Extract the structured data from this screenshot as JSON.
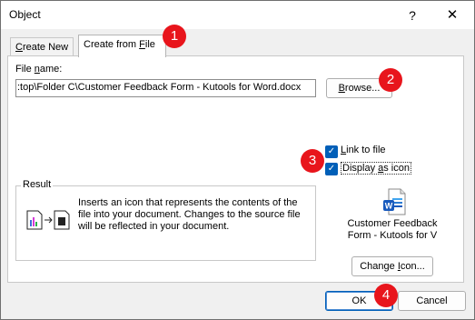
{
  "window": {
    "title": "Object",
    "help_symbol": "?",
    "close_symbol": "✕"
  },
  "tabs": [
    {
      "label_pre": "",
      "label_mnemonic": "C",
      "label_post": "reate New",
      "active": false
    },
    {
      "label_pre": "Create from ",
      "label_mnemonic": "F",
      "label_post": "ile",
      "active": true
    }
  ],
  "file": {
    "label_pre": "File ",
    "label_mnemonic": "n",
    "label_post": "ame:",
    "value": ":top\\Folder C\\Customer Feedback Form - Kutools for Word.docx",
    "browse_pre": "",
    "browse_mnemonic": "B",
    "browse_post": "rowse..."
  },
  "options": {
    "link_to_file": {
      "label_pre": "",
      "label_mnemonic": "L",
      "label_post": "ink to file",
      "checked": true
    },
    "display_as_icon": {
      "label_pre": "Display ",
      "label_mnemonic": "a",
      "label_post": "s icon",
      "checked": true
    }
  },
  "result": {
    "legend": "Result",
    "text": "Inserts an icon that represents the contents of the file into your document.  Changes to the source file will be reflected in your document."
  },
  "icon_preview": {
    "icon": "word-document-icon",
    "caption_line1": "Customer Feedback",
    "caption_line2": "Form - Kutools for V"
  },
  "change_icon": {
    "label_pre": "Change ",
    "label_mnemonic": "I",
    "label_post": "con..."
  },
  "footer": {
    "ok_label": "OK",
    "cancel_label": "Cancel"
  },
  "callouts": [
    "1",
    "2",
    "3",
    "4"
  ],
  "colors": {
    "accent": "#005fb8",
    "callout": "#e8151c",
    "word_blue": "#185abd"
  }
}
